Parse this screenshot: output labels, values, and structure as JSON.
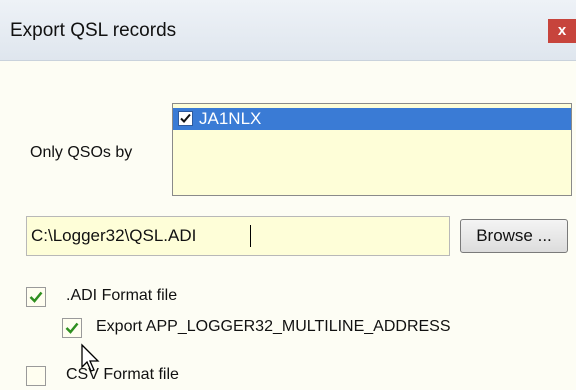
{
  "window": {
    "title": "Export QSL records",
    "close_label": "x"
  },
  "filter": {
    "label": "Only QSOs by",
    "items": [
      {
        "label": "JA1NLX",
        "checked": true,
        "selected": true
      }
    ]
  },
  "file": {
    "path": "C:\\Logger32\\QSL.ADI",
    "browse_label": "Browse ..."
  },
  "options": {
    "adi": {
      "label": ".ADI Format file",
      "checked": true
    },
    "multiline": {
      "label": "Export APP_LOGGER32_MULTILINE_ADDRESS",
      "checked": true
    },
    "csv": {
      "label": "CSV Format file",
      "checked": false
    }
  },
  "colors": {
    "check": "#2f8f1f",
    "selection": "#3a7bd5",
    "field": "#fefed8"
  }
}
